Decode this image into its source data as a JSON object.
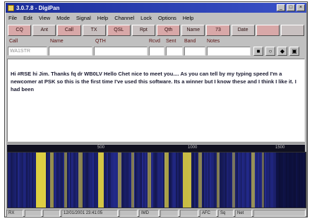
{
  "window": {
    "title": "3.0.7.8 - DigiPan"
  },
  "menubar": {
    "items": [
      "File",
      "Edit",
      "View",
      "Mode",
      "Signal",
      "Help",
      "Channel",
      "Lock",
      "Options",
      "Help"
    ]
  },
  "toolbar": {
    "buttons": [
      "CQ",
      "Ant",
      "Call",
      "TX",
      "QSL",
      "Rpt",
      "Qth",
      "Name",
      "73",
      "Date",
      "",
      ""
    ]
  },
  "fields": {
    "labels": {
      "call": "Call",
      "name": "Name",
      "qth": "QTH",
      "rst_sent": "Rcvd",
      "rst_rcvd": "Sent",
      "band": "Band",
      "notes": "Notes"
    },
    "call_value": "WA1STR",
    "name_value": "",
    "qth_value": "",
    "rcvd_value": "",
    "sent_value": "",
    "band_value": "",
    "notes_value": ""
  },
  "rx": {
    "text": "Hi #RSE hi Jim. Thanks fq dr WB0LV Hello Chet nice to meet you.... As you can tell by my typing speed I'm a newcomer at PSK so this is the first time I've used this software. Its a winner but I know these and I think I like it. I had been"
  },
  "waterfall": {
    "scale_labels": [
      "500",
      "1000",
      "1500"
    ]
  },
  "statusbar": {
    "cells": [
      "RX",
      "",
      "",
      "12/01/2001 23:41:05",
      "",
      "IMD",
      "",
      "",
      "AFC",
      "Sq",
      "Net",
      ""
    ]
  },
  "colors": {
    "titlebar": "#1a2c9a",
    "waterfall_bg": "#1a1e6a",
    "signal": "#e8d840"
  }
}
